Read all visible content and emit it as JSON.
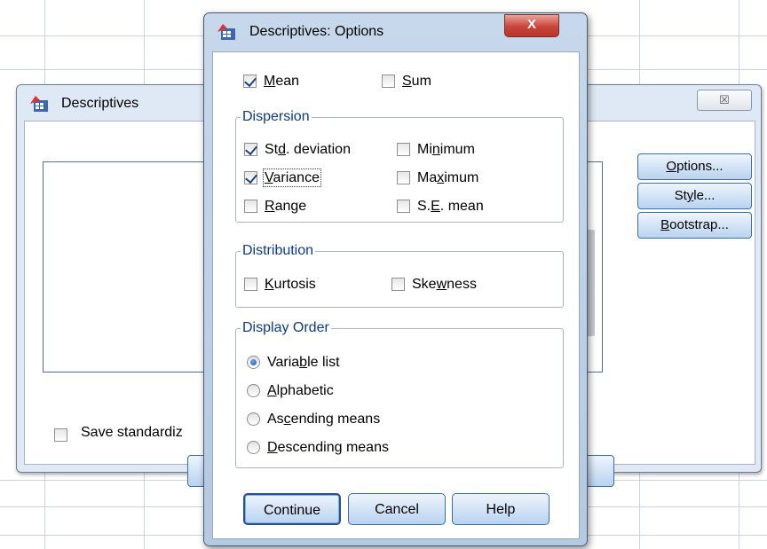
{
  "colors": {
    "dialog_frame": "#c7d8ec",
    "close_red": "#c9443a",
    "group_label": "#0b3a8a",
    "button_fill": "#b9d3f0",
    "checkbox_check": "#1b3f8a"
  },
  "background_dialog": {
    "title": "Descriptives",
    "close_glyph": "☒",
    "buttons": [
      {
        "key": "O",
        "rest": "ptions..."
      },
      {
        "pre": "St",
        "key": "y",
        "rest": "le..."
      },
      {
        "key": "B",
        "rest": "ootstrap..."
      }
    ],
    "save_label": "Save standardiz",
    "save_checked": false
  },
  "options_dialog": {
    "title": "Descriptives: Options",
    "close_glyph": "X",
    "mean": {
      "key": "M",
      "rest": "ean",
      "checked": true
    },
    "sum": {
      "key": "S",
      "rest": "um",
      "checked": false
    },
    "dispersion": {
      "legend": "Dispersion",
      "items": [
        {
          "pre": "St",
          "key": "d",
          "rest": ". deviation",
          "checked": true
        },
        {
          "pre": "Mi",
          "key": "n",
          "rest": "imum",
          "checked": false
        },
        {
          "pre": "",
          "key": "V",
          "rest": "ariance",
          "checked": true
        },
        {
          "pre": "Ma",
          "key": "x",
          "rest": "imum",
          "checked": false
        },
        {
          "pre": "",
          "key": "R",
          "rest": "ange",
          "checked": false
        },
        {
          "pre": "S.",
          "key": "E",
          "rest": ". mean",
          "checked": false
        }
      ]
    },
    "distribution": {
      "legend": "Distribution",
      "items": [
        {
          "pre": "",
          "key": "K",
          "rest": "urtosis",
          "checked": false
        },
        {
          "pre": "Ske",
          "key": "w",
          "rest": "ness",
          "checked": false
        }
      ]
    },
    "display_order": {
      "legend": "Display Order",
      "items": [
        {
          "pre": "Varia",
          "key": "b",
          "rest": "le list",
          "selected": true
        },
        {
          "pre": "",
          "key": "A",
          "rest": "lphabetic",
          "selected": false
        },
        {
          "pre": "As",
          "key": "c",
          "rest": "ending means",
          "selected": false
        },
        {
          "pre": "",
          "key": "D",
          "rest": "escending means",
          "selected": false
        }
      ]
    },
    "buttons": {
      "continue": "Continue",
      "cancel": "Cancel",
      "help": "Help"
    }
  }
}
